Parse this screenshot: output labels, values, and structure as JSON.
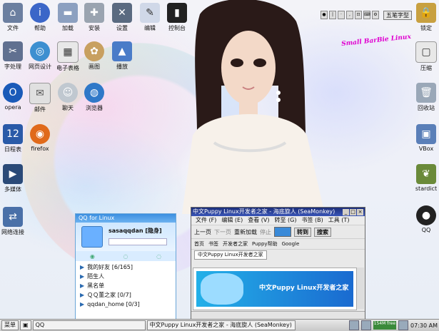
{
  "desktop": {
    "brand_text": "Small BarBie Linux",
    "ime_label": "五笔字型",
    "icons": [
      {
        "label": "文件",
        "icon": "home-folder-icon"
      },
      {
        "label": "帮助",
        "icon": "help-icon"
      },
      {
        "label": "加载",
        "icon": "usb-drive-icon"
      },
      {
        "label": "安装",
        "icon": "install-icon"
      },
      {
        "label": "设置",
        "icon": "settings-tools-icon"
      },
      {
        "label": "编辑",
        "icon": "editor-pen-icon"
      },
      {
        "label": "控制台",
        "icon": "terminal-icon"
      },
      {
        "label": "字处理",
        "icon": "word-processor-icon"
      },
      {
        "label": "网页设计",
        "icon": "web-design-icon"
      },
      {
        "label": "电子表格",
        "icon": "spreadsheet-icon"
      },
      {
        "label": "画图",
        "icon": "paint-icon"
      },
      {
        "label": "播放",
        "icon": "player-icon"
      },
      {
        "label": "opera",
        "icon": "opera-icon"
      },
      {
        "label": "邮件",
        "icon": "mail-icon"
      },
      {
        "label": "聊天",
        "icon": "chat-icon"
      },
      {
        "label": "浏览器",
        "icon": "browser-icon"
      },
      {
        "label": "日程表",
        "icon": "calendar-icon"
      },
      {
        "label": "firefox",
        "icon": "firefox-icon"
      },
      {
        "label": "多媒体",
        "icon": "multimedia-icon"
      },
      {
        "label": "网络连接",
        "icon": "network-icon"
      },
      {
        "label": "锁定",
        "icon": "lock-icon"
      },
      {
        "label": "压缩",
        "icon": "archive-icon"
      },
      {
        "label": "回收站",
        "icon": "trash-icon"
      },
      {
        "label": "VBox",
        "icon": "virtualbox-icon"
      },
      {
        "label": "stardict",
        "icon": "dictionary-icon"
      },
      {
        "label": "QQ",
        "icon": "qq-penguin-icon"
      }
    ]
  },
  "qq_window": {
    "title": "QQ for Linux",
    "username": "sasaqqdan",
    "status": "[隐身]",
    "groups": [
      {
        "label": "我的好友 [6/165]"
      },
      {
        "label": "陌生人"
      },
      {
        "label": "黑名单"
      },
      {
        "label": "ＱＱ董之家 [0/7]"
      },
      {
        "label": "qqdan_home [0/3]"
      }
    ]
  },
  "browser": {
    "title": "中文Puppy Linux开发者之家 - 海底旋人 (SeaMonkey)",
    "menu": [
      "文件 (F)",
      "编辑 (E)",
      "查看 (V)",
      "转至 (G)",
      "书签 (B)",
      "工具 (T)"
    ],
    "nav": {
      "back": "上一页",
      "forward": "下一页",
      "reload": "重新加载",
      "stop": "停止",
      "go": "转到",
      "search": "搜索"
    },
    "bookmarks": [
      "首页",
      "书签",
      "开发者之家",
      "Puppy帮助",
      "Google"
    ],
    "tab_label": "中文Puppy Linux开发者之家",
    "banner_text": "中文Puppy Linux开发者之家"
  },
  "taskbar": {
    "start_label": "菜单",
    "task_qq": "QQ",
    "task_browser": "中文Puppy Linux开发者之家 - 海底旋人 (SeaMonkey)",
    "mem_label": "154M free",
    "clock": "07:30 AM"
  }
}
